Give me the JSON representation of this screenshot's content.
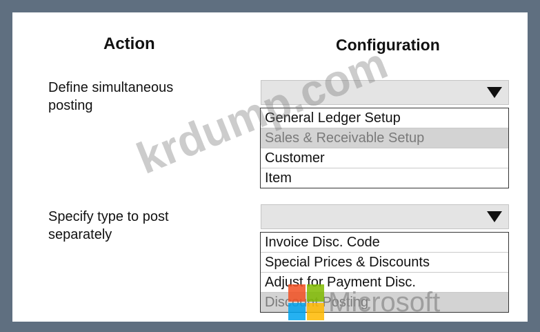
{
  "headers": {
    "action": "Action",
    "configuration": "Configuration"
  },
  "rows": [
    {
      "action": "Define simultaneous posting",
      "dropdown_value": "",
      "options": [
        "General Ledger Setup",
        "Sales & Receivable Setup",
        "Customer",
        "Item"
      ],
      "highlighted_option": "Sales & Receivable Setup"
    },
    {
      "action": "Specify type to post separately",
      "dropdown_value": "",
      "options": [
        "Invoice Disc. Code",
        "Special Prices & Discounts",
        "Adjust for Payment Disc.",
        "Discount Posting"
      ],
      "highlighted_option": "Discount Posting"
    }
  ],
  "watermark": {
    "text": "krdump.com",
    "brand": "Microsoft",
    "brand_colors": [
      "#f25022",
      "#7fba00",
      "#00a4ef",
      "#ffb900"
    ]
  },
  "colors": {
    "frame": "#5f6f80",
    "dropdown_bg": "#e4e4e4",
    "highlight": "#d3d3d3"
  }
}
